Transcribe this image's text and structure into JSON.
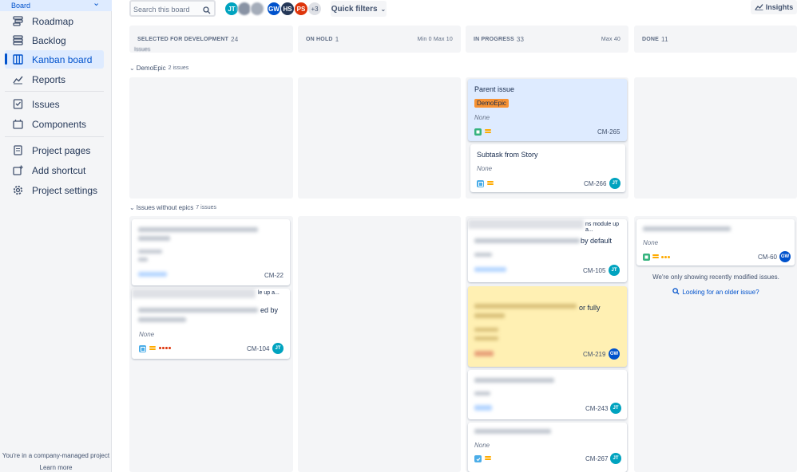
{
  "sidebar": {
    "project_sub": "Board",
    "items": [
      {
        "label": "Roadmap",
        "icon": "roadmap-icon"
      },
      {
        "label": "Backlog",
        "icon": "backlog-icon"
      },
      {
        "label": "Kanban board",
        "icon": "kanban-board-icon",
        "active": true
      },
      {
        "label": "Reports",
        "icon": "reports-icon"
      },
      {
        "label": "Issues",
        "icon": "issues-icon"
      },
      {
        "label": "Components",
        "icon": "components-icon"
      },
      {
        "label": "Project pages",
        "icon": "project-pages-icon"
      },
      {
        "label": "Add shortcut",
        "icon": "add-shortcut-icon"
      },
      {
        "label": "Project settings",
        "icon": "gear-icon"
      }
    ],
    "footer_text": "You're in a company-managed project",
    "footer_link": "Learn more"
  },
  "toolbar": {
    "search_placeholder": "Search this board",
    "avatars": [
      {
        "initials": "JT",
        "color": "#00a3bf"
      },
      {
        "initials": "",
        "color": "#8993a4"
      },
      {
        "initials": "GW",
        "color": "#0052cc"
      },
      {
        "initials": "HS",
        "color": "#253858"
      },
      {
        "initials": "PS",
        "color": "#de350b"
      }
    ],
    "more_avatars": "+3",
    "quick_filters": "Quick filters",
    "insights": "Insights"
  },
  "columns": [
    {
      "name": "SELECTED FOR DEVELOPMENT",
      "count": "24",
      "limits": ""
    },
    {
      "name": "ON HOLD",
      "count": "1",
      "limits": "Min 0  Max 10"
    },
    {
      "name": "IN PROGRESS",
      "count": "33",
      "limits": "Max 40"
    },
    {
      "name": "DONE",
      "count": "11",
      "limits": ""
    }
  ],
  "swimlanes": {
    "cut_off_text": "Issues",
    "epic": {
      "name": "DemoEpic",
      "count": "2 issues"
    },
    "no_epic": {
      "name": "Issues without epics",
      "count": "7 issues"
    }
  },
  "cards": {
    "parent": {
      "title": "Parent issue",
      "epic": "DemoEpic",
      "fix": "None",
      "key": "CM-265"
    },
    "subtask": {
      "title": "Subtask from Story",
      "fix": "None",
      "key": "CM-266",
      "assignee": "JT"
    },
    "cm22": {
      "key": "CM-22"
    },
    "cm104": {
      "partial_header": "le up a...",
      "partial_title": "ed by",
      "fix": "None",
      "key": "CM-104",
      "assignee": "JT"
    },
    "cm105": {
      "partial_header": "ns module up a...",
      "partial_title": "by default",
      "key": "CM-105",
      "assignee": "JT"
    },
    "cm219": {
      "partial_title": "or fully",
      "key": "CM-219",
      "assignee": "GW"
    },
    "cm243": {
      "key": "CM-243",
      "assignee": "JT"
    },
    "cm267": {
      "fix": "None",
      "key": "CM-267",
      "assignee": "JT"
    },
    "cm60": {
      "fix": "None",
      "key": "CM-60",
      "assignee": "GW"
    }
  },
  "done_column": {
    "message": "We're only showing recently modified issues.",
    "link": "Looking for an older issue?"
  },
  "colors": {
    "accent": "#0052cc",
    "story": "#36b37e",
    "subtask": "#4bade8",
    "priority_medium": "#ffab00",
    "epic_lozenge": "#f79233"
  }
}
